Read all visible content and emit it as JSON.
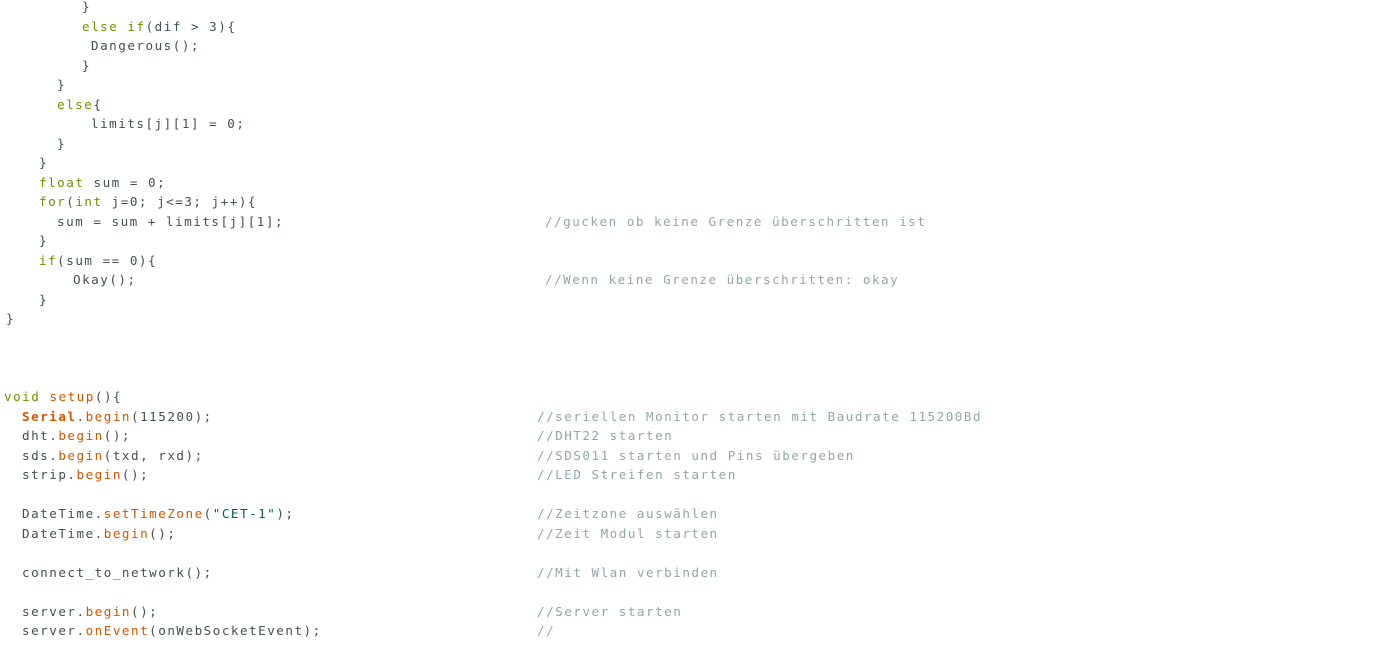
{
  "colors": {
    "background": "#ffffff",
    "text": "#434f54",
    "keyword": "#728e00",
    "function": "#d35400",
    "string": "#005c5f",
    "comment": "#95a5a6"
  },
  "lines": [
    {
      "indent": 82,
      "tokens": [
        {
          "t": "}",
          "c": "plain"
        }
      ]
    },
    {
      "indent": 82,
      "tokens": [
        {
          "t": "else if",
          "c": "kw"
        },
        {
          "t": "(dif > 3){",
          "c": "plain"
        }
      ]
    },
    {
      "indent": 91,
      "tokens": [
        {
          "t": "Dangerous();",
          "c": "plain"
        }
      ]
    },
    {
      "indent": 82,
      "tokens": [
        {
          "t": "}",
          "c": "plain"
        }
      ]
    },
    {
      "indent": 57,
      "tokens": [
        {
          "t": "}",
          "c": "plain"
        }
      ]
    },
    {
      "indent": 57,
      "tokens": [
        {
          "t": "else",
          "c": "kw"
        },
        {
          "t": "{",
          "c": "plain"
        }
      ]
    },
    {
      "indent": 91,
      "tokens": [
        {
          "t": "limits[j][1] = 0;",
          "c": "plain"
        }
      ]
    },
    {
      "indent": 57,
      "tokens": [
        {
          "t": "}",
          "c": "plain"
        }
      ]
    },
    {
      "indent": 39,
      "tokens": [
        {
          "t": "}",
          "c": "plain"
        }
      ]
    },
    {
      "indent": 39,
      "tokens": [
        {
          "t": "float",
          "c": "kw"
        },
        {
          "t": " sum = 0;",
          "c": "plain"
        }
      ]
    },
    {
      "indent": 39,
      "tokens": [
        {
          "t": "for",
          "c": "kw"
        },
        {
          "t": "(",
          "c": "plain"
        },
        {
          "t": "int",
          "c": "kw"
        },
        {
          "t": " j=0; j<=3; j++){",
          "c": "plain"
        }
      ]
    },
    {
      "indent": 57,
      "tokens": [
        {
          "t": "sum = sum + limits[j][1];",
          "c": "plain"
        }
      ],
      "comment": "//gucken ob keine Grenze überschritten ist"
    },
    {
      "indent": 39,
      "tokens": [
        {
          "t": "}",
          "c": "plain"
        }
      ]
    },
    {
      "indent": 39,
      "tokens": [
        {
          "t": "if",
          "c": "kw"
        },
        {
          "t": "(sum == 0){",
          "c": "plain"
        }
      ]
    },
    {
      "indent": 73,
      "tokens": [
        {
          "t": "Okay();",
          "c": "plain"
        }
      ],
      "comment": "//Wenn keine Grenze überschritten: okay"
    },
    {
      "indent": 39,
      "tokens": [
        {
          "t": "}",
          "c": "plain"
        }
      ]
    },
    {
      "indent": 6,
      "tokens": [
        {
          "t": "}",
          "c": "plain"
        }
      ]
    },
    {
      "indent": 0,
      "tokens": []
    },
    {
      "indent": 0,
      "tokens": []
    },
    {
      "indent": 0,
      "tokens": []
    },
    {
      "indent": 4,
      "tokens": [
        {
          "t": "void",
          "c": "kw"
        },
        {
          "t": " ",
          "c": "plain"
        },
        {
          "t": "setup",
          "c": "fn"
        },
        {
          "t": "(){",
          "c": "plain"
        }
      ]
    },
    {
      "indent": 22,
      "tokens": [
        {
          "t": "Serial",
          "c": "cls"
        },
        {
          "t": ".",
          "c": "plain"
        },
        {
          "t": "begin",
          "c": "fn"
        },
        {
          "t": "(115200);",
          "c": "plain"
        }
      ],
      "comment": "//seriellen Monitor starten mit Baudrate 115200Bd"
    },
    {
      "indent": 22,
      "tokens": [
        {
          "t": "dht.",
          "c": "plain"
        },
        {
          "t": "begin",
          "c": "fn"
        },
        {
          "t": "();",
          "c": "plain"
        }
      ],
      "comment": "//DHT22 starten"
    },
    {
      "indent": 22,
      "tokens": [
        {
          "t": "sds.",
          "c": "plain"
        },
        {
          "t": "begin",
          "c": "fn"
        },
        {
          "t": "(txd, rxd);",
          "c": "plain"
        }
      ],
      "comment": "//SDS011 starten und Pins übergeben"
    },
    {
      "indent": 22,
      "tokens": [
        {
          "t": "strip.",
          "c": "plain"
        },
        {
          "t": "begin",
          "c": "fn"
        },
        {
          "t": "();",
          "c": "plain"
        }
      ],
      "comment": "//LED Streifen starten"
    },
    {
      "indent": 0,
      "tokens": []
    },
    {
      "indent": 22,
      "tokens": [
        {
          "t": "DateTime.",
          "c": "plain"
        },
        {
          "t": "setTimeZone",
          "c": "fn"
        },
        {
          "t": "(",
          "c": "plain"
        },
        {
          "t": "\"CET-1\"",
          "c": "str"
        },
        {
          "t": ");",
          "c": "plain"
        }
      ],
      "comment": "//Zeitzone auswählen"
    },
    {
      "indent": 22,
      "tokens": [
        {
          "t": "DateTime.",
          "c": "plain"
        },
        {
          "t": "begin",
          "c": "fn"
        },
        {
          "t": "();",
          "c": "plain"
        }
      ],
      "comment": "//Zeit Modul starten"
    },
    {
      "indent": 0,
      "tokens": []
    },
    {
      "indent": 22,
      "tokens": [
        {
          "t": "connect_to_network();",
          "c": "plain"
        }
      ],
      "comment": "//Mit Wlan verbinden"
    },
    {
      "indent": 0,
      "tokens": []
    },
    {
      "indent": 22,
      "tokens": [
        {
          "t": "server.",
          "c": "plain"
        },
        {
          "t": "begin",
          "c": "fn"
        },
        {
          "t": "();",
          "c": "plain"
        }
      ],
      "comment": "//Server starten"
    },
    {
      "indent": 22,
      "tokens": [
        {
          "t": "server.",
          "c": "plain"
        },
        {
          "t": "onEvent",
          "c": "fn"
        },
        {
          "t": "(onWebSocketEvent);",
          "c": "plain"
        }
      ],
      "comment": "//"
    }
  ]
}
